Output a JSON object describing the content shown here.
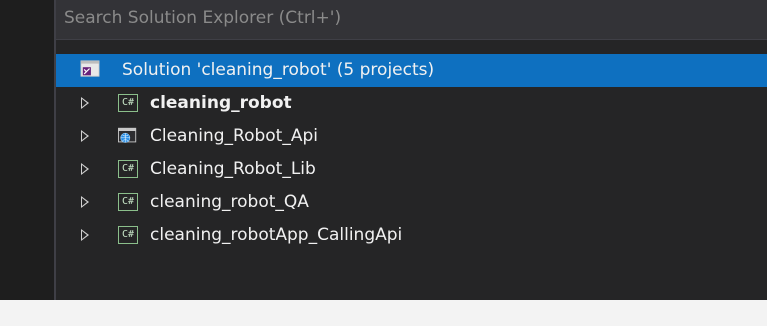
{
  "search": {
    "placeholder": "Search Solution Explorer (Ctrl+')"
  },
  "solution": {
    "label": "Solution 'cleaning_robot' (5 projects)",
    "icon": "visual-studio-solution-icon",
    "selected": true
  },
  "projects": [
    {
      "label": "cleaning_robot",
      "icon": "csharp-project-icon",
      "icon_text": "C#",
      "bold": true
    },
    {
      "label": "Cleaning_Robot_Api",
      "icon": "web-project-icon",
      "icon_text": "",
      "bold": false
    },
    {
      "label": "Cleaning_Robot_Lib",
      "icon": "csharp-project-icon",
      "icon_text": "C#",
      "bold": false
    },
    {
      "label": "cleaning_robot_QA",
      "icon": "csharp-project-icon",
      "icon_text": "C#",
      "bold": false
    },
    {
      "label": "cleaning_robotApp_CallingApi",
      "icon": "csharp-project-icon",
      "icon_text": "C#",
      "bold": false
    }
  ],
  "colors": {
    "panel_background": "#252526",
    "selection": "#0e70c0",
    "text": "#f1f1f1",
    "placeholder": "#8a8a8a"
  }
}
